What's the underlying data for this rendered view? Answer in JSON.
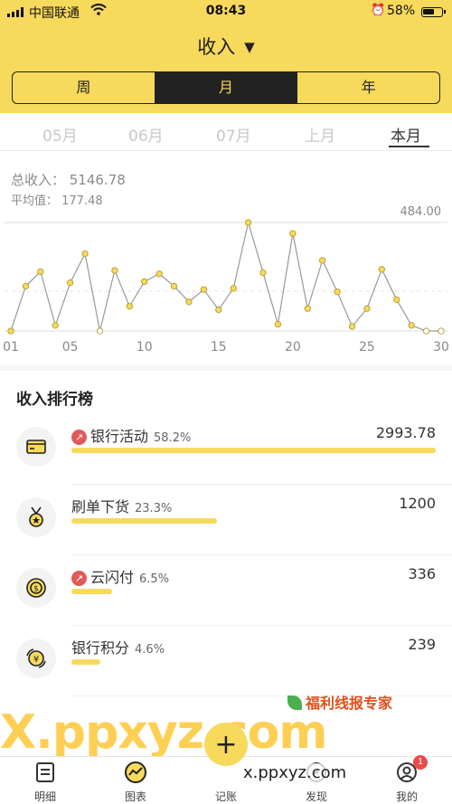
{
  "status_bar": {
    "carrier": "中国联通",
    "time": "08:43",
    "battery": "58%"
  },
  "header": {
    "title": "收入",
    "caret": "▼"
  },
  "segments": [
    {
      "label": "周",
      "active": false
    },
    {
      "label": "月",
      "active": true
    },
    {
      "label": "年",
      "active": false
    }
  ],
  "periods": [
    {
      "label": "05月",
      "active": false
    },
    {
      "label": "06月",
      "active": false
    },
    {
      "label": "07月",
      "active": false
    },
    {
      "label": "上月",
      "active": false
    },
    {
      "label": "本月",
      "active": true
    }
  ],
  "summary": {
    "total": "总收入： 5146.78",
    "average": "平均值： 177.48"
  },
  "chart_data": {
    "type": "line",
    "x": [
      1,
      2,
      3,
      4,
      5,
      6,
      7,
      8,
      9,
      10,
      11,
      12,
      13,
      14,
      15,
      16,
      17,
      18,
      19,
      20,
      21,
      22,
      23,
      24,
      25,
      26,
      27,
      28,
      29,
      30
    ],
    "values": [
      0,
      200,
      265,
      25,
      215,
      345,
      0,
      270,
      110,
      220,
      255,
      200,
      130,
      185,
      95,
      190,
      484,
      260,
      30,
      435,
      100,
      315,
      175,
      20,
      100,
      275,
      140,
      25,
      0,
      0
    ],
    "tick_labels": [
      "01",
      "05",
      "10",
      "15",
      "20",
      "25",
      "30"
    ],
    "max_label": "484.00",
    "ylim": [
      0,
      484
    ],
    "average": 177.48,
    "grid": false,
    "line_color": "#999999",
    "point_color": "#f7d95c"
  },
  "ranking": {
    "title": "收入排行榜",
    "items": [
      {
        "name": "银行活动",
        "pct": "58.2%",
        "amount": "2993.78",
        "fraction": 0.582,
        "hot": true,
        "icon": "card-icon"
      },
      {
        "name": "刷单下货",
        "pct": "23.3%",
        "amount": "1200",
        "fraction": 0.233,
        "hot": false,
        "icon": "medal-icon"
      },
      {
        "name": "云闪付",
        "pct": "6.5%",
        "amount": "336",
        "fraction": 0.065,
        "hot": true,
        "icon": "coin-icon"
      },
      {
        "name": "银行积分",
        "pct": "4.6%",
        "amount": "239",
        "fraction": 0.046,
        "hot": false,
        "icon": "yuan-exchange-icon"
      }
    ]
  },
  "tabbar": {
    "items": [
      {
        "label": "明细",
        "icon": "list-icon"
      },
      {
        "label": "图表",
        "icon": "chart-icon"
      },
      {
        "label": "记账",
        "icon": "add-icon"
      },
      {
        "label": "发现",
        "icon": "compass-icon"
      },
      {
        "label": "我的",
        "icon": "profile-icon",
        "badge": "1"
      }
    ],
    "fab": "+"
  },
  "watermark": {
    "big": "X.ppxyz.com",
    "small": "x.ppxyz.com",
    "brand": "福利线报专家"
  },
  "colors": {
    "accent": "#f7d95c",
    "dark": "#222222",
    "hot": "#e05a5a"
  }
}
